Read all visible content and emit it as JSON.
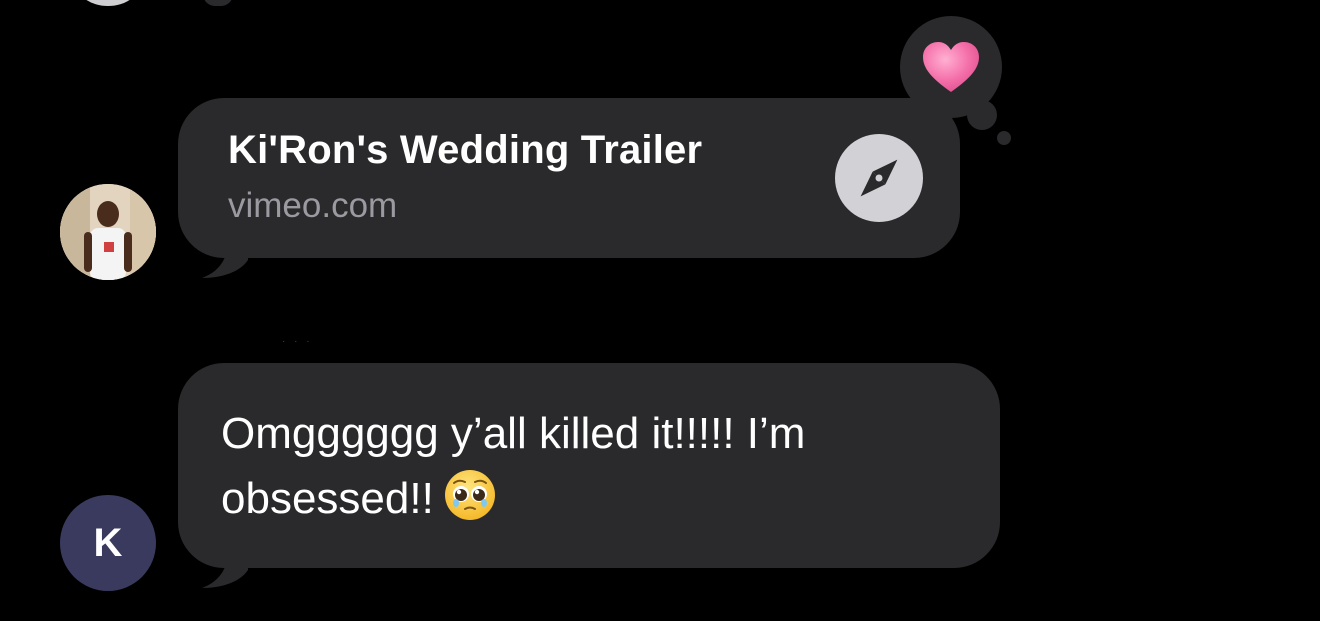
{
  "thread": {
    "link_preview": {
      "title": "Ki'Ron's Wedding Trailer",
      "domain": "vimeo.com",
      "action_icon": "compass-icon",
      "reaction": "heart"
    },
    "message": {
      "text": "Omgggggg y’all killed it!!!!! I’m obsessed!!",
      "emoji": "pleading-face-emoji"
    },
    "avatar_letter": "K"
  },
  "colors": {
    "background": "#000000",
    "bubble": "#2a2a2c",
    "secondary_text": "#9a9aa0",
    "avatar_letter_bg": "#3a3a5e",
    "heart": "#f46fa9"
  }
}
